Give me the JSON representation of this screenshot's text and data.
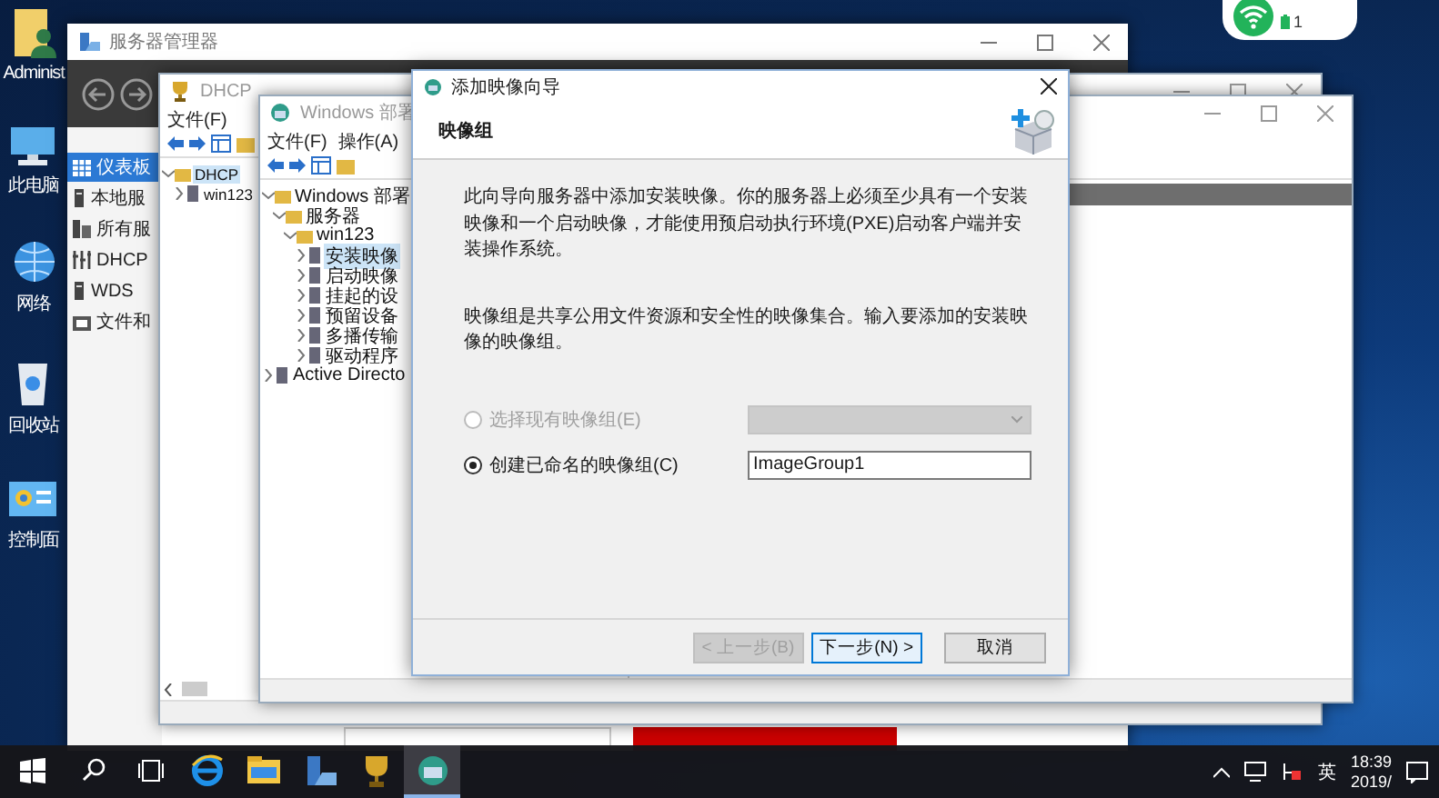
{
  "desktop_icons": [
    {
      "label": "Administ"
    },
    {
      "label": "此电脑"
    },
    {
      "label": "网络"
    },
    {
      "label": "回收站"
    },
    {
      "label": "控制面"
    }
  ],
  "network_widget": {
    "value": "1"
  },
  "server_manager": {
    "title": "服务器管理器",
    "nav": [
      {
        "label": "仪表板",
        "selected": true
      },
      {
        "label": "本地服",
        "selected": false
      },
      {
        "label": "所有服",
        "selected": false
      },
      {
        "label": "DHCP",
        "selected": false
      },
      {
        "label": "WDS",
        "selected": false
      },
      {
        "label": "文件和",
        "selected": false
      }
    ]
  },
  "dhcp_window": {
    "title": "DHCP",
    "menu": [
      "文件(F)"
    ],
    "tree": [
      {
        "label": "DHCP",
        "expanded": true,
        "selected": true,
        "children": [
          {
            "label": "win123",
            "expanded": false,
            "selected": false
          }
        ]
      }
    ]
  },
  "wds_window": {
    "title": "Windows 部署",
    "menu": [
      "文件(F)",
      "操作(A)"
    ],
    "tree": [
      {
        "label": "Windows 部署",
        "expanded": true,
        "selected": false,
        "children": [
          {
            "label": "服务器",
            "expanded": true,
            "selected": false,
            "children": [
              {
                "label": "win123",
                "expanded": true,
                "selected": false,
                "children": [
                  {
                    "label": "安装映像",
                    "expanded": false,
                    "selected": true
                  },
                  {
                    "label": "启动映像",
                    "expanded": false,
                    "selected": false
                  },
                  {
                    "label": "挂起的设",
                    "expanded": false,
                    "selected": false
                  },
                  {
                    "label": "预留设备",
                    "expanded": false,
                    "selected": false
                  },
                  {
                    "label": "多播传输",
                    "expanded": false,
                    "selected": false
                  },
                  {
                    "label": "驱动程序",
                    "expanded": false,
                    "selected": false
                  }
                ]
              }
            ]
          }
        ]
      },
      {
        "label": "Active Directo",
        "expanded": false,
        "selected": false
      }
    ]
  },
  "wizard": {
    "title": "添加映像向导",
    "heading": "映像组",
    "intro": "此向导向服务器中添加安装映像。你的服务器上必须至少具有一个安装映像和一个启动映像，才能使用预启动执行环境(PXE)启动客户端并安装操作系统。",
    "description": "映像组是共享公用文件资源和安全性的映像集合。输入要添加的安装映像的映像组。",
    "options": [
      {
        "label": "选择现有映像组(E)",
        "kind": "dropdown",
        "selected": false,
        "disabled": true
      },
      {
        "label": "创建已命名的映像组(C)",
        "kind": "text",
        "selected": true,
        "disabled": false,
        "value": "ImageGroup1"
      }
    ],
    "buttons": [
      {
        "label": "< 上一步(B)",
        "disabled": true,
        "default": false
      },
      {
        "label": "下一步(N) >",
        "disabled": false,
        "default": true
      },
      {
        "label": "取消",
        "disabled": false,
        "default": false
      }
    ]
  },
  "taskbar": {
    "apps": [
      {
        "kind": "start",
        "selected": false
      },
      {
        "kind": "search",
        "selected": false
      },
      {
        "kind": "taskview",
        "selected": false
      },
      {
        "kind": "browser",
        "selected": false
      },
      {
        "kind": "folder",
        "selected": false
      },
      {
        "kind": "servermanager",
        "selected": false
      },
      {
        "kind": "dhcp",
        "selected": false
      },
      {
        "kind": "wds",
        "selected": true
      }
    ],
    "ime": "英",
    "time": "18:39",
    "date": "2019/"
  }
}
